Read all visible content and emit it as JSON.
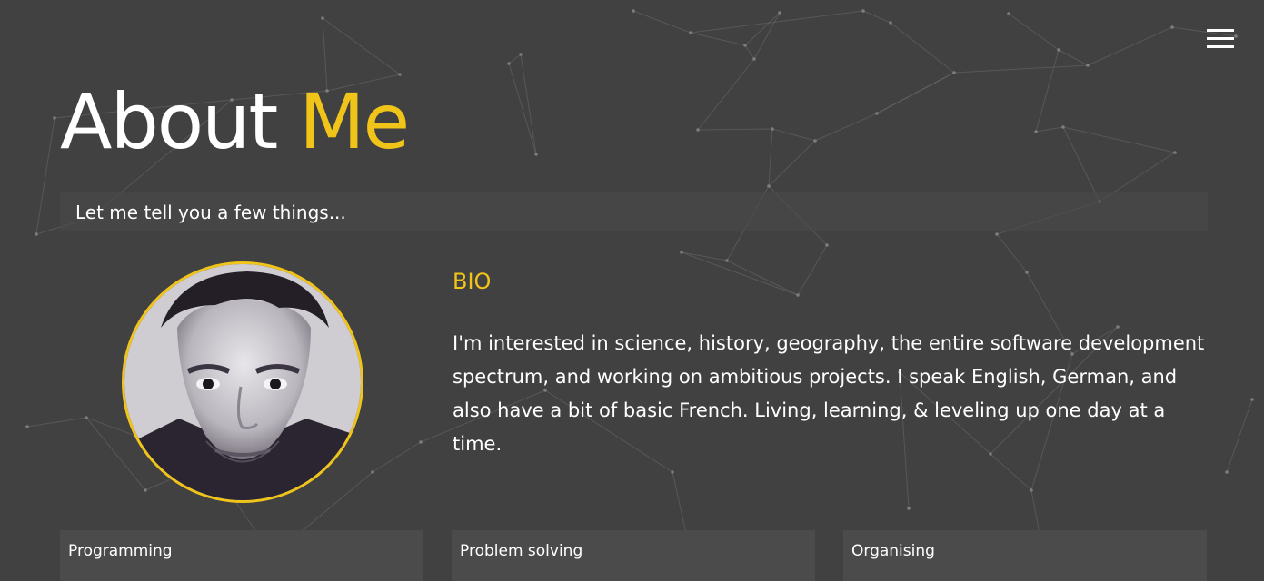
{
  "header": {
    "title_primary": "About",
    "title_accent": "Me",
    "subtitle": "Let me tell you a few things...",
    "menu_icon": "hamburger-menu-icon"
  },
  "profile": {
    "avatar_icon": "profile-photo",
    "bio_heading": "BIO",
    "bio_text": "I'm interested in science, history, geography, the entire software development spectrum, and working on ambitious projects. I speak English, German, and also have a bit of basic French. Living, learning, & leveling up one day at a time."
  },
  "skills": [
    {
      "label": "Programming"
    },
    {
      "label": "Problem solving"
    },
    {
      "label": "Organising"
    }
  ],
  "colors": {
    "background": "#414141",
    "accent": "#f0c419",
    "text": "#ffffff",
    "panel": "#4b4b4b"
  }
}
